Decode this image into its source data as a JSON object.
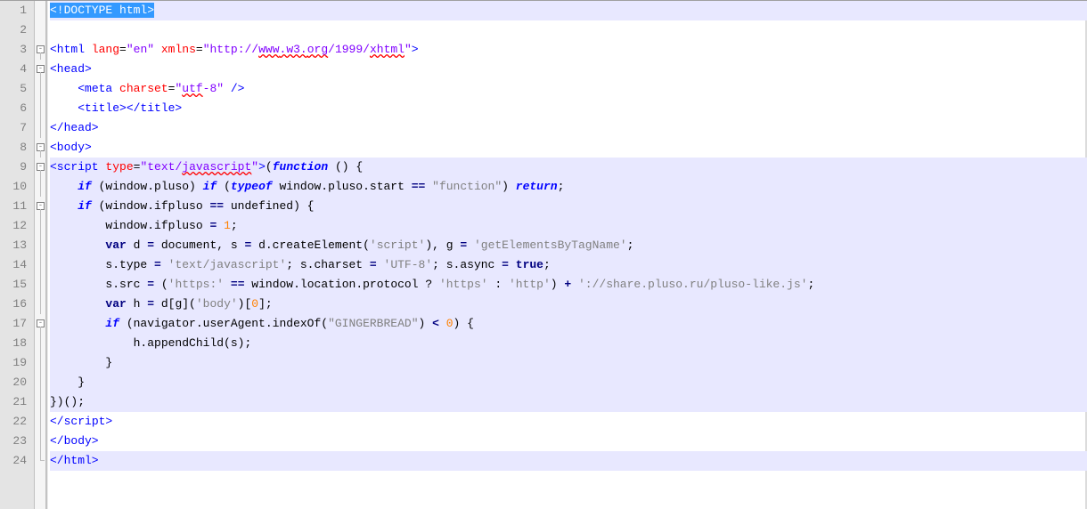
{
  "lineCount": 24,
  "highlightedLines": [
    1,
    9,
    10,
    11,
    12,
    13,
    14,
    15,
    16,
    17,
    18,
    19,
    20,
    21,
    24
  ],
  "fold": {
    "3": "box",
    "4": "box",
    "8": "box",
    "9": "box",
    "11": "box",
    "17": "box"
  },
  "code": {
    "l1": {
      "selected": "<!DOCTYPE html>"
    },
    "l3": {
      "t": [
        [
          "<html ",
          "tag"
        ],
        [
          "lang",
          "attr"
        ],
        [
          "=",
          "txt"
        ],
        [
          "\"en\"",
          "str"
        ],
        [
          " ",
          "txt"
        ],
        [
          "xmlns",
          "attr"
        ],
        [
          "=",
          "txt"
        ],
        [
          "\"http://",
          "str"
        ],
        [
          "www",
          "str squig"
        ],
        [
          ".w3.",
          "str squig"
        ],
        [
          "org",
          "str squig"
        ],
        [
          "/1999/",
          "str"
        ],
        [
          "xhtml",
          "str squig"
        ],
        [
          "\"",
          "str"
        ],
        [
          ">",
          "tag"
        ]
      ]
    },
    "l4": {
      "t": [
        [
          "<head>",
          "tag"
        ]
      ]
    },
    "l5": {
      "pad": "    ",
      "t": [
        [
          "<meta ",
          "tag"
        ],
        [
          "charset",
          "attr"
        ],
        [
          "=",
          "txt"
        ],
        [
          "\"",
          "str"
        ],
        [
          "utf",
          "str squig"
        ],
        [
          "-8\"",
          "str"
        ],
        [
          " />",
          "tag"
        ]
      ]
    },
    "l6": {
      "pad": "    ",
      "t": [
        [
          "<title></title>",
          "tag"
        ]
      ]
    },
    "l7": {
      "t": [
        [
          "</head>",
          "tag"
        ]
      ]
    },
    "l8": {
      "t": [
        [
          "<body>",
          "tag"
        ]
      ]
    },
    "l9": {
      "t": [
        [
          "<script ",
          "tag"
        ],
        [
          "type",
          "attr"
        ],
        [
          "=",
          "txt"
        ],
        [
          "\"text/",
          "str"
        ],
        [
          "javascript",
          "str squig"
        ],
        [
          "\"",
          "str"
        ],
        [
          ">",
          "tag"
        ],
        [
          "(",
          "txt"
        ],
        [
          "function",
          "kw"
        ],
        [
          " () {",
          "txt"
        ]
      ]
    },
    "l10": {
      "pad": "    ",
      "t": [
        [
          "if",
          "kw"
        ],
        [
          " (window.pluso) ",
          "txt"
        ],
        [
          "if",
          "kw"
        ],
        [
          " (",
          "txt"
        ],
        [
          "typeof",
          "kw"
        ],
        [
          " window.pluso.start ",
          "txt"
        ],
        [
          "==",
          "op"
        ],
        [
          " ",
          "txt"
        ],
        [
          "\"function\"",
          "lit"
        ],
        [
          ") ",
          "txt"
        ],
        [
          "return",
          "kw"
        ],
        [
          ";",
          "txt"
        ]
      ]
    },
    "l11": {
      "pad": "    ",
      "t": [
        [
          "if",
          "kw"
        ],
        [
          " (window.ifpluso ",
          "txt"
        ],
        [
          "==",
          "op"
        ],
        [
          " undefined) {",
          "txt"
        ]
      ]
    },
    "l12": {
      "pad": "        ",
      "t": [
        [
          "window.ifpluso ",
          "txt"
        ],
        [
          "=",
          "op"
        ],
        [
          " ",
          "txt"
        ],
        [
          "1",
          "num"
        ],
        [
          ";",
          "txt"
        ]
      ]
    },
    "l13": {
      "pad": "        ",
      "t": [
        [
          "var",
          "kw2"
        ],
        [
          " d ",
          "txt"
        ],
        [
          "=",
          "op"
        ],
        [
          " document, s ",
          "txt"
        ],
        [
          "=",
          "op"
        ],
        [
          " d.createElement(",
          "txt"
        ],
        [
          "'script'",
          "lit"
        ],
        [
          "), g ",
          "txt"
        ],
        [
          "=",
          "op"
        ],
        [
          " ",
          "txt"
        ],
        [
          "'getElementsByTagName'",
          "lit"
        ],
        [
          ";",
          "txt"
        ]
      ]
    },
    "l14": {
      "pad": "        ",
      "t": [
        [
          "s.type ",
          "txt"
        ],
        [
          "=",
          "op"
        ],
        [
          " ",
          "txt"
        ],
        [
          "'text/javascript'",
          "lit"
        ],
        [
          "; s.charset ",
          "txt"
        ],
        [
          "=",
          "op"
        ],
        [
          " ",
          "txt"
        ],
        [
          "'UTF-8'",
          "lit"
        ],
        [
          "; s.async ",
          "txt"
        ],
        [
          "=",
          "op"
        ],
        [
          " ",
          "txt"
        ],
        [
          "true",
          "kw2"
        ],
        [
          ";",
          "txt"
        ]
      ]
    },
    "l15": {
      "pad": "        ",
      "t": [
        [
          "s.src ",
          "txt"
        ],
        [
          "=",
          "op"
        ],
        [
          " (",
          "txt"
        ],
        [
          "'https:'",
          "lit"
        ],
        [
          " ",
          "txt"
        ],
        [
          "==",
          "op"
        ],
        [
          " window.location.protocol ? ",
          "txt"
        ],
        [
          "'https'",
          "lit"
        ],
        [
          " : ",
          "txt"
        ],
        [
          "'http'",
          "lit"
        ],
        [
          ") ",
          "txt"
        ],
        [
          "+",
          "op"
        ],
        [
          " ",
          "txt"
        ],
        [
          "'://share.pluso.ru/pluso-like.js'",
          "lit"
        ],
        [
          ";",
          "txt"
        ]
      ]
    },
    "l16": {
      "pad": "        ",
      "t": [
        [
          "var",
          "kw2"
        ],
        [
          " h ",
          "txt"
        ],
        [
          "=",
          "op"
        ],
        [
          " d[g](",
          "txt"
        ],
        [
          "'body'",
          "lit"
        ],
        [
          ")[",
          "txt"
        ],
        [
          "0",
          "num"
        ],
        [
          "];",
          "txt"
        ]
      ]
    },
    "l17": {
      "pad": "        ",
      "t": [
        [
          "if",
          "kw"
        ],
        [
          " (navigator.userAgent.indexOf(",
          "txt"
        ],
        [
          "\"GINGERBREAD\"",
          "lit"
        ],
        [
          ") ",
          "txt"
        ],
        [
          "<",
          "op"
        ],
        [
          " ",
          "txt"
        ],
        [
          "0",
          "num"
        ],
        [
          ") {",
          "txt"
        ]
      ]
    },
    "l18": {
      "pad": "            ",
      "t": [
        [
          "h.appendChild(s);",
          "txt"
        ]
      ]
    },
    "l19": {
      "pad": "        ",
      "t": [
        [
          "}",
          "txt"
        ]
      ]
    },
    "l20": {
      "pad": "    ",
      "t": [
        [
          "}",
          "txt"
        ]
      ]
    },
    "l21": {
      "t": [
        [
          "})();",
          "txt"
        ]
      ]
    },
    "l22": {
      "t": [
        [
          "</",
          "tag"
        ],
        [
          "script",
          "tag"
        ],
        [
          ">",
          "tag"
        ]
      ]
    },
    "l23": {
      "t": [
        [
          "</body>",
          "tag"
        ]
      ]
    },
    "l24": {
      "t": [
        [
          "</html>",
          "tag"
        ]
      ]
    }
  }
}
